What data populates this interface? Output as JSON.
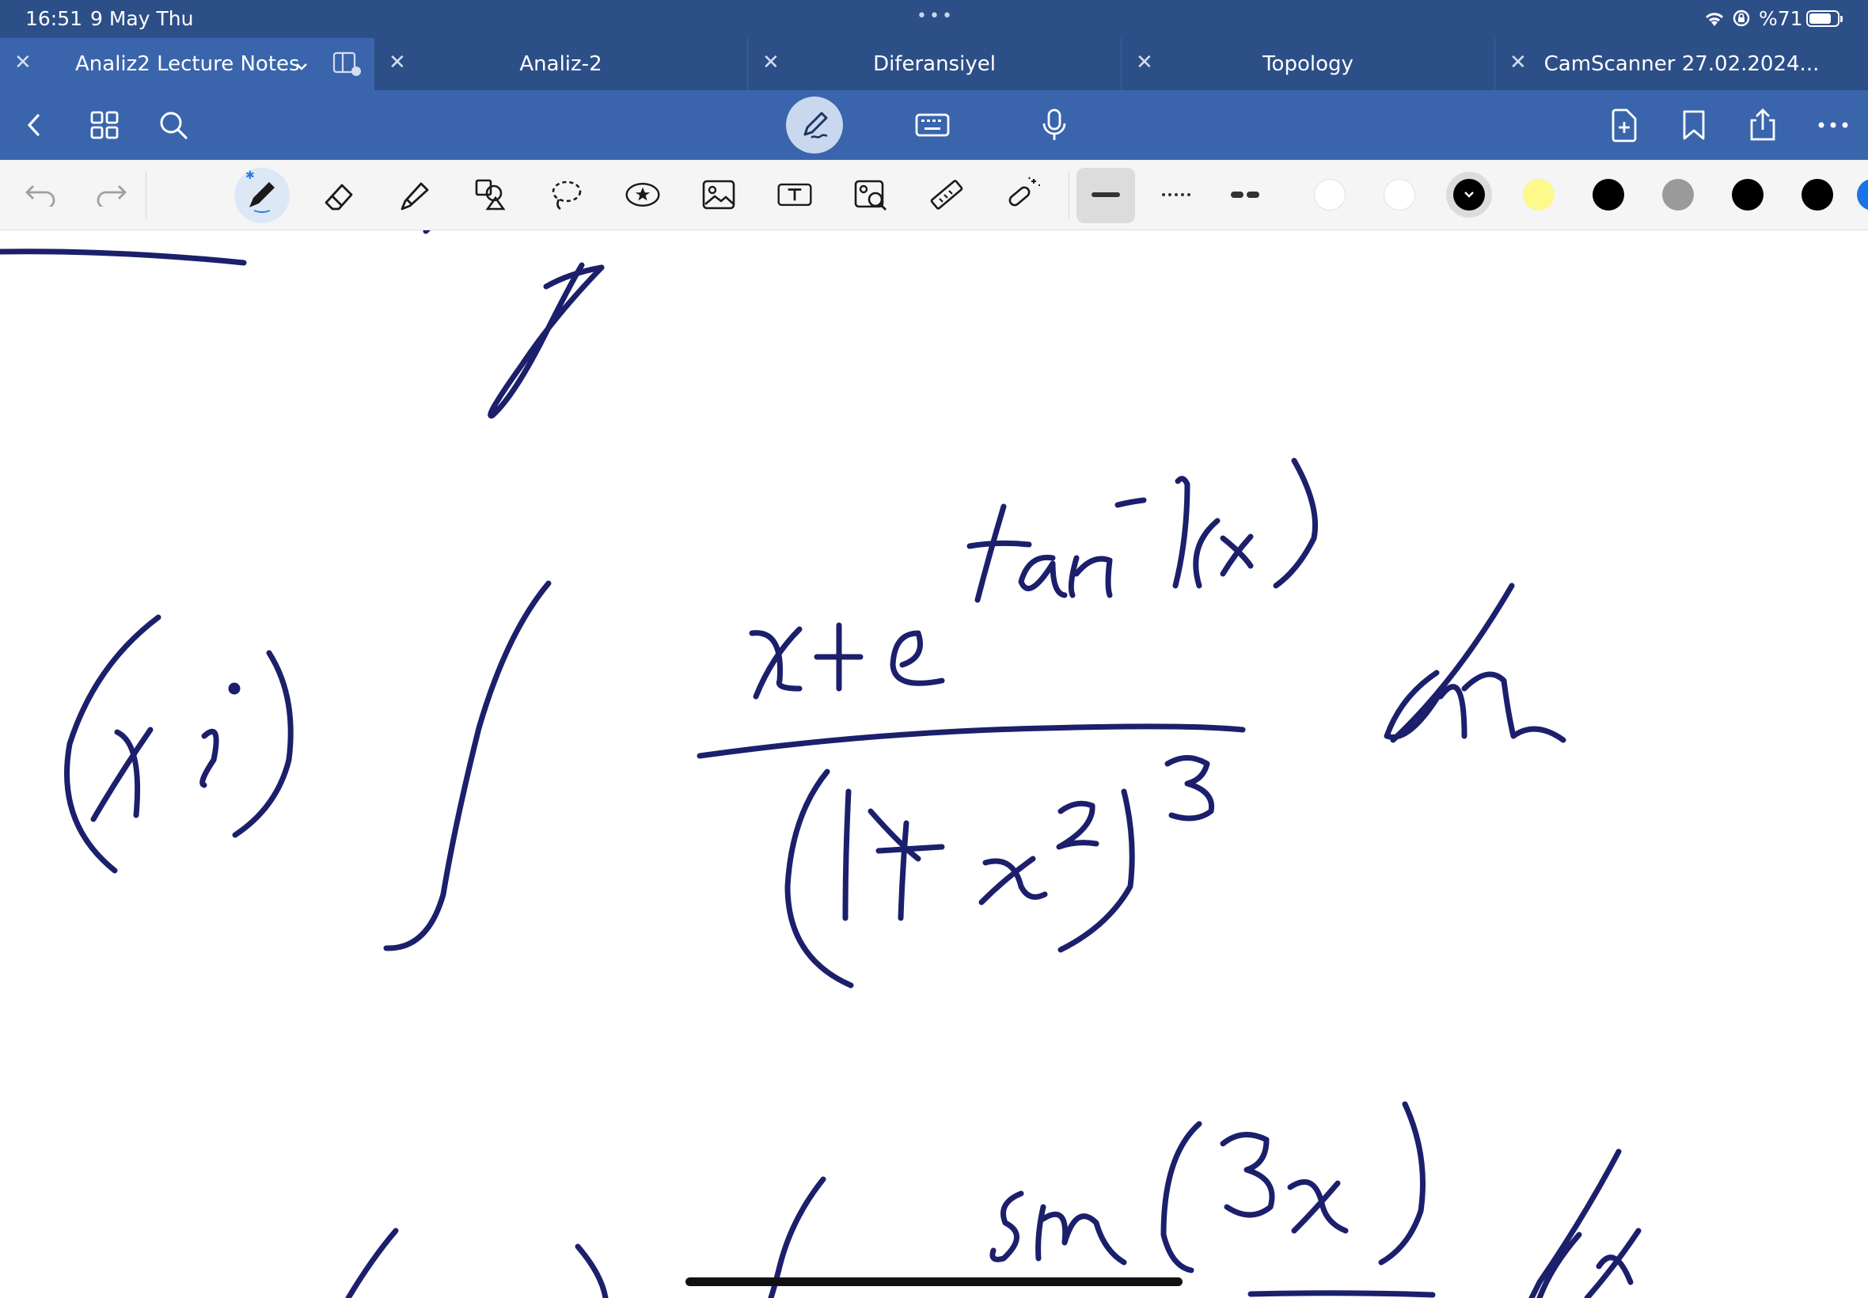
{
  "status_bar": {
    "time": "16:51",
    "date": "9 May Thu",
    "battery_percent_label": "%71",
    "battery_level": 0.71,
    "multitask_dots": "•••"
  },
  "tabs": [
    {
      "label": "Analiz2 Lecture Notes",
      "active": true
    },
    {
      "label": "Analiz-2",
      "active": false
    },
    {
      "label": "Diferansiyel",
      "active": false
    },
    {
      "label": "Topology",
      "active": false
    },
    {
      "label": "CamScanner 27.02.2024...",
      "active": false
    }
  ],
  "toolbar": {
    "left_icons": [
      "back-chevron-icon",
      "thumbnails-grid-icon",
      "search-icon"
    ],
    "mode_icons": [
      "pen-mode-icon",
      "keyboard-icon",
      "microphone-icon"
    ],
    "right_icons": [
      "add-page-icon",
      "bookmark-icon",
      "share-icon",
      "more-icon"
    ]
  },
  "drawing_tools": {
    "tools": [
      "undo-icon",
      "redo-icon",
      "pen-tool-icon",
      "eraser-tool-icon",
      "highlighter-tool-icon",
      "shapes-tool-icon",
      "lasso-tool-icon",
      "sticker-tool-icon",
      "image-tool-icon",
      "text-tool-icon",
      "image-scan-tool-icon",
      "ruler-tool-icon",
      "laser-pointer-tool-icon"
    ],
    "active_tool": "pen-tool-icon",
    "stroke_styles": [
      "solid",
      "dotted",
      "dashed"
    ],
    "active_stroke_style": "solid",
    "colors": [
      "#ffffff",
      "#ffffff",
      "#000000",
      "#fdf98a",
      "#000000",
      "#9a9a9a",
      "#000000",
      "#000000",
      "#1a73e8"
    ],
    "selected_color_index": 2
  },
  "accent_color": "#3a65ac",
  "ink_color": "#1c1f6b"
}
